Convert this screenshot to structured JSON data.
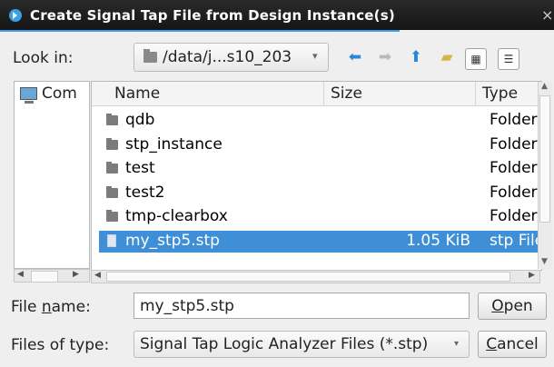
{
  "window": {
    "title": "Create Signal Tap File from Design Instance(s)",
    "close_glyph": "×"
  },
  "lookin": {
    "label": "Look in:",
    "path": "/data/j...s10_203"
  },
  "toolbar": {
    "back_icon": "back-arrow-icon",
    "forward_icon": "forward-arrow-icon",
    "up_icon": "up-arrow-icon",
    "new_folder_icon": "new-folder-icon",
    "detail_view_icon": "detail-view-icon",
    "list_view_icon": "list-view-icon"
  },
  "sidebar": {
    "items": [
      {
        "label": "Com",
        "icon": "computer-icon"
      }
    ]
  },
  "filelist": {
    "columns": {
      "name": "Name",
      "size": "Size",
      "type": "Type"
    },
    "rows": [
      {
        "name": "qdb",
        "size": "",
        "type": "Folder",
        "kind": "folder"
      },
      {
        "name": "stp_instance",
        "size": "",
        "type": "Folder",
        "kind": "folder"
      },
      {
        "name": "test",
        "size": "",
        "type": "Folder",
        "kind": "folder"
      },
      {
        "name": "test2",
        "size": "",
        "type": "Folder",
        "kind": "folder"
      },
      {
        "name": "tmp-clearbox",
        "size": "",
        "type": "Folder",
        "kind": "folder"
      },
      {
        "name": "my_stp5.stp",
        "size": "1.05 KiB",
        "type": "stp File",
        "kind": "file",
        "selected": true
      }
    ]
  },
  "filename": {
    "label_pre": "File ",
    "label_u": "n",
    "label_post": "ame:",
    "value": "my_stp5.stp"
  },
  "filetype": {
    "label": "Files of type:",
    "value": "Signal Tap Logic Analyzer Files (*.stp)"
  },
  "buttons": {
    "open_u": "O",
    "open_rest": "pen",
    "cancel_u": "C",
    "cancel_rest": "ancel"
  },
  "colors": {
    "selection": "#3e8fd6",
    "accent": "#3da2e3",
    "titlebar": "#1c1c1c"
  }
}
